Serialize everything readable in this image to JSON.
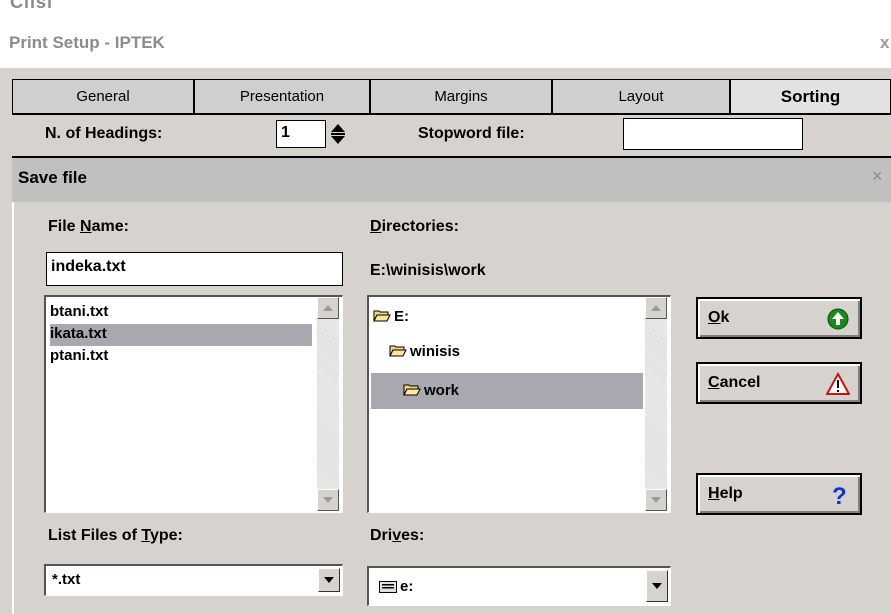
{
  "background_window": {
    "cut_title": "Ciisi"
  },
  "print_setup": {
    "title": "Print Setup - IPTEK",
    "close": "x",
    "tabs": [
      {
        "label": "General"
      },
      {
        "label": "Presentation"
      },
      {
        "label": "Margins"
      },
      {
        "label": "Layout"
      },
      {
        "label": "Sorting",
        "active": true
      }
    ],
    "headings_label": "N. of Headings:",
    "headings_value": "1",
    "stopword_label": "Stopword file:",
    "stopword_value": ""
  },
  "save_dialog": {
    "title": "Save file",
    "close": "×",
    "file_name_label_pre": "File ",
    "file_name_label_u": "N",
    "file_name_label_post": "ame:",
    "file_name_value": "indeka.txt",
    "files": [
      {
        "name": "btani.txt"
      },
      {
        "name": "ikata.txt",
        "selected": true
      },
      {
        "name": "ptani.txt"
      }
    ],
    "directories_label_u": "D",
    "directories_label_post": "irectories:",
    "current_path": "E:\\winisis\\work",
    "dirs": [
      {
        "name": "E:"
      },
      {
        "name": "winisis"
      },
      {
        "name": "work",
        "selected": true
      }
    ],
    "list_type_label_pre": "List Files of ",
    "list_type_label_u": "T",
    "list_type_label_post": "ype:",
    "list_type_value": "*.txt",
    "drives_label_pre": "Dri",
    "drives_label_u": "v",
    "drives_label_post": "es:",
    "drives_value": "e:",
    "buttons": {
      "ok_u": "O",
      "ok_rest": "k",
      "cancel_u": "C",
      "cancel_rest": "ancel",
      "help_u": "H",
      "help_rest": "elp"
    },
    "colors": {
      "ok_icon": "#1a8a1a",
      "cancel_icon": "#d01010",
      "help_icon": "#1030d0",
      "selection": "#a8a8b0"
    }
  }
}
